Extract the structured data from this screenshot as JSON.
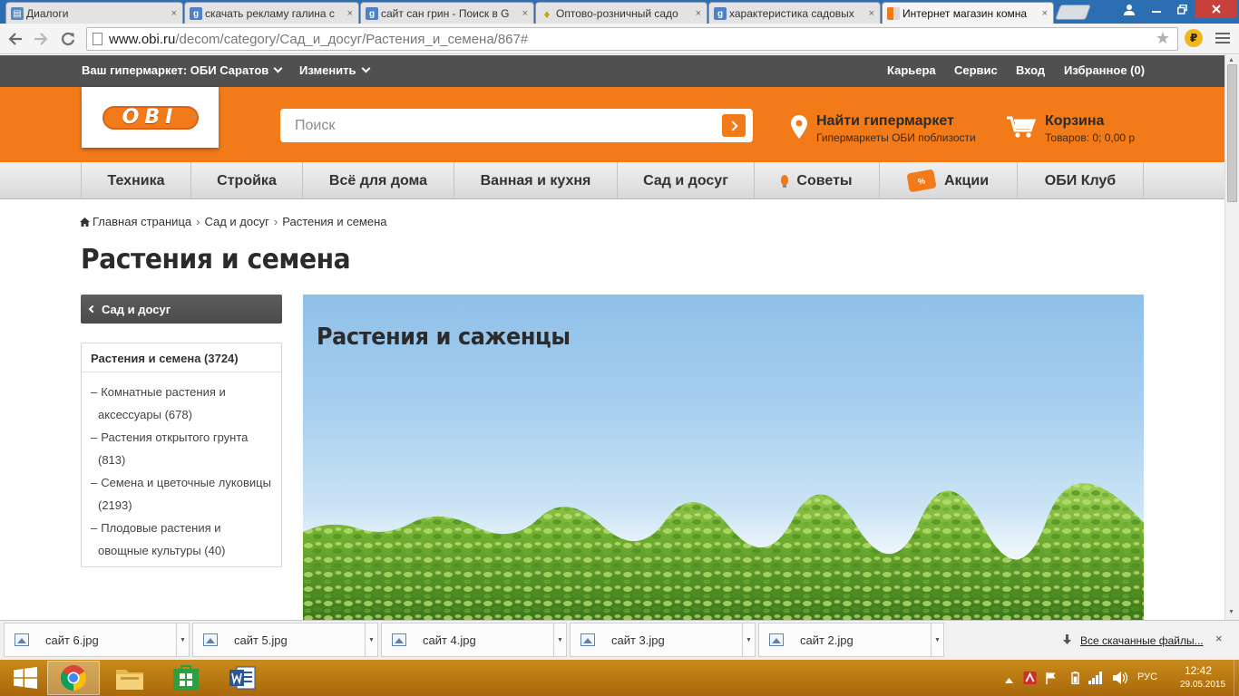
{
  "browser": {
    "tabs": [
      {
        "title": "Диалоги",
        "favicon": "dialog-icon"
      },
      {
        "title": "скачать рекламу галина с",
        "favicon": "google-icon"
      },
      {
        "title": "сайт сан грин - Поиск в G",
        "favicon": "google-icon"
      },
      {
        "title": "Оптово-розничный садо",
        "favicon": "bulb-icon"
      },
      {
        "title": "характеристика садовых",
        "favicon": "google-icon"
      },
      {
        "title": "Интернет магазин комна",
        "favicon": "obi-icon"
      }
    ],
    "tab_close_glyph": "×",
    "address": {
      "host": "www.obi.ru",
      "path": "/decom/category/Сад_и_досуг/Растения_и_семена/867#"
    },
    "extension_badge": "₽"
  },
  "site": {
    "storebar": {
      "store_label": "Ваш гипермаркет: ОБИ Саратов",
      "change_label": "Изменить",
      "links": {
        "career": "Карьера",
        "service": "Сервис",
        "login": "Вход",
        "favorites": "Избранное (0)"
      }
    },
    "header": {
      "logo_text": "OBI",
      "logo_mark": "®",
      "search_placeholder": "Поиск",
      "finder_title": "Найти гипермаркет",
      "finder_subtitle": "Гипермаркеты ОБИ поблизости",
      "cart_title": "Корзина",
      "cart_subtitle": "Товаров: 0; 0,00 р"
    },
    "nav": {
      "tech": "Техника",
      "build": "Стройка",
      "home": "Всё для дома",
      "bath": "Ванная и кухня",
      "garden": "Сад и досуг",
      "tips": "Советы",
      "promo_badge": "%",
      "promo": "Акции",
      "club": "ОБИ Клуб"
    },
    "breadcrumb": {
      "items": [
        "Главная страница",
        "Сад и досуг",
        "Растения и семена"
      ],
      "separator": "›"
    },
    "page_title": "Растения и семена",
    "sidebar": {
      "back_label": "Сад и досуг",
      "category_header": "Растения и семена (3724)",
      "dash": "–",
      "items": [
        "Комнатные растения и аксессуары (678)",
        "Растения открытого грунта (813)",
        "Семена и цветочные луковицы (2193)",
        "Плодовые растения и овощные культуры (40)"
      ]
    },
    "hero": {
      "title": "Растения и саженцы"
    }
  },
  "downloads": {
    "items": [
      "сайт 6.jpg",
      "сайт 5.jpg",
      "сайт 4.jpg",
      "сайт 3.jpg",
      "сайт 2.jpg"
    ],
    "show_all": "Все скачанные файлы...",
    "close_glyph": "×"
  },
  "taskbar": {
    "language": "РУС",
    "time": "12:42",
    "date": "29.05.2015"
  },
  "colors": {
    "obi_orange": "#f27a19",
    "storebar_bg": "#505050",
    "nav_bg": "#e3e3e3",
    "taskbar_bg": "#b8770a",
    "tabstrip_bg": "#2b6fb2"
  }
}
